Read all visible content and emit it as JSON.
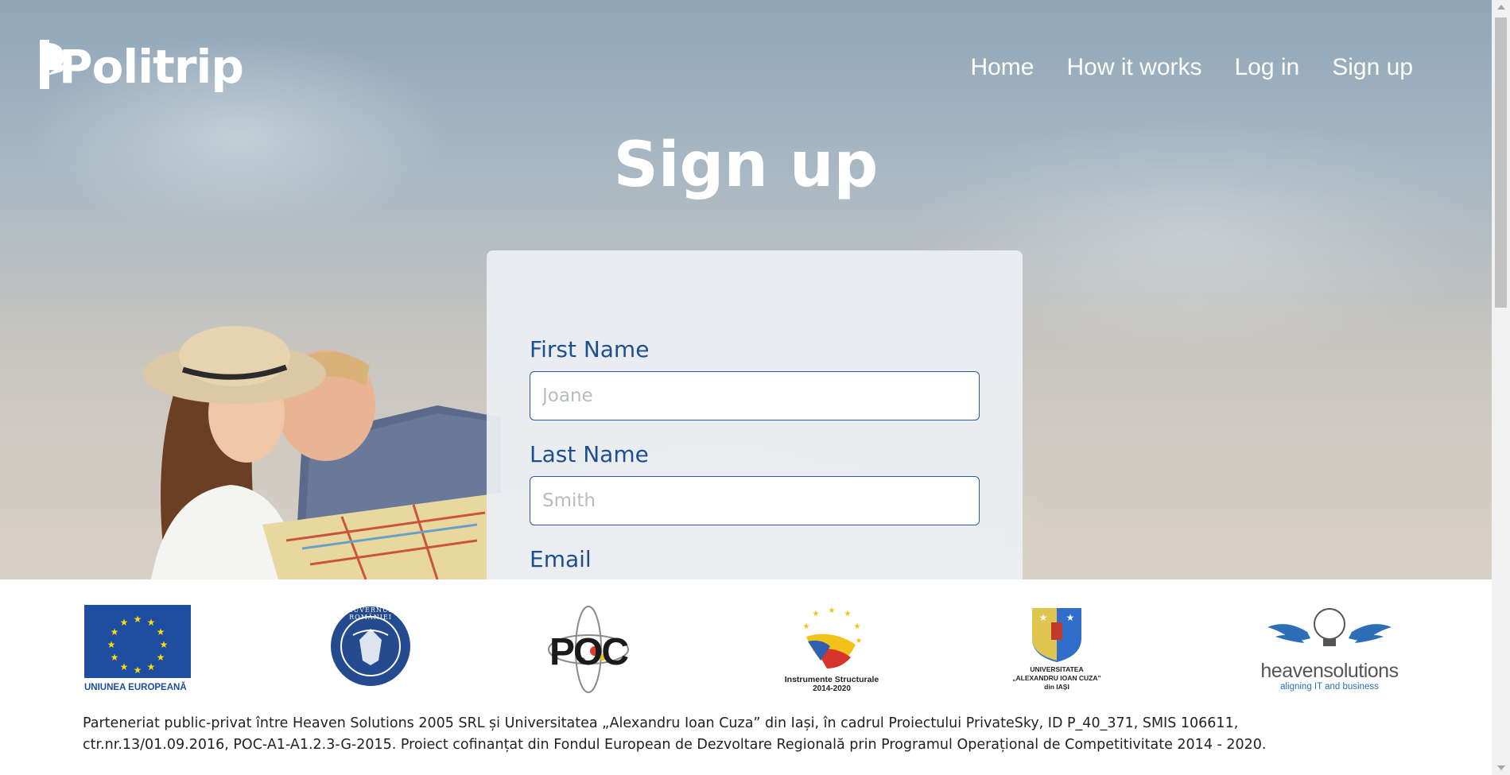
{
  "brand": {
    "logo_text": "Politrip"
  },
  "nav": {
    "items": [
      {
        "label": "Home"
      },
      {
        "label": "How it works"
      },
      {
        "label": "Log in"
      },
      {
        "label": "Sign up"
      }
    ]
  },
  "page": {
    "title": "Sign up"
  },
  "form": {
    "first_name": {
      "label": "First Name",
      "placeholder": "Joane",
      "value": ""
    },
    "last_name": {
      "label": "Last Name",
      "placeholder": "Smith",
      "value": ""
    },
    "email": {
      "label": "Email"
    }
  },
  "footer": {
    "partners": [
      {
        "name": "eu-flag-logo",
        "caption": "UNIUNEA EUROPEANĂ"
      },
      {
        "name": "guvernul-romaniei-seal",
        "caption": "GUVERNUL ROMÂNIEI"
      },
      {
        "name": "poc-logo",
        "caption": "POC"
      },
      {
        "name": "instrumente-structurale-logo",
        "caption": "Instrumente Structurale",
        "caption2": "2014-2020"
      },
      {
        "name": "uaic-logo",
        "caption": "UNIVERSITATEA",
        "caption2": "„ALEXANDRU IOAN CUZA”",
        "caption3": "din IAȘI"
      },
      {
        "name": "heaven-solutions-logo",
        "caption": "heavensolutions",
        "caption2": "aligning IT and business"
      }
    ],
    "text": "Parteneriat public-privat între Heaven Solutions 2005 SRL și Universitatea „Alexandru Ioan Cuza” din Iași, în cadrul Proiectului PrivateSky, ID P_40_371, SMIS 106611, ctr.nr.13/01.09.2016, POC-A1-A1.2.3-G-2015. Proiect cofinanțat din Fondul European de Dezvoltare Regională prin Programul Operațional de Competitivitate 2014 - 2020."
  },
  "colors": {
    "label_blue": "#1d4f8f",
    "input_border": "#2c5a9a",
    "eu_blue": "#1f4ea1",
    "eu_gold": "#ffdd00"
  }
}
